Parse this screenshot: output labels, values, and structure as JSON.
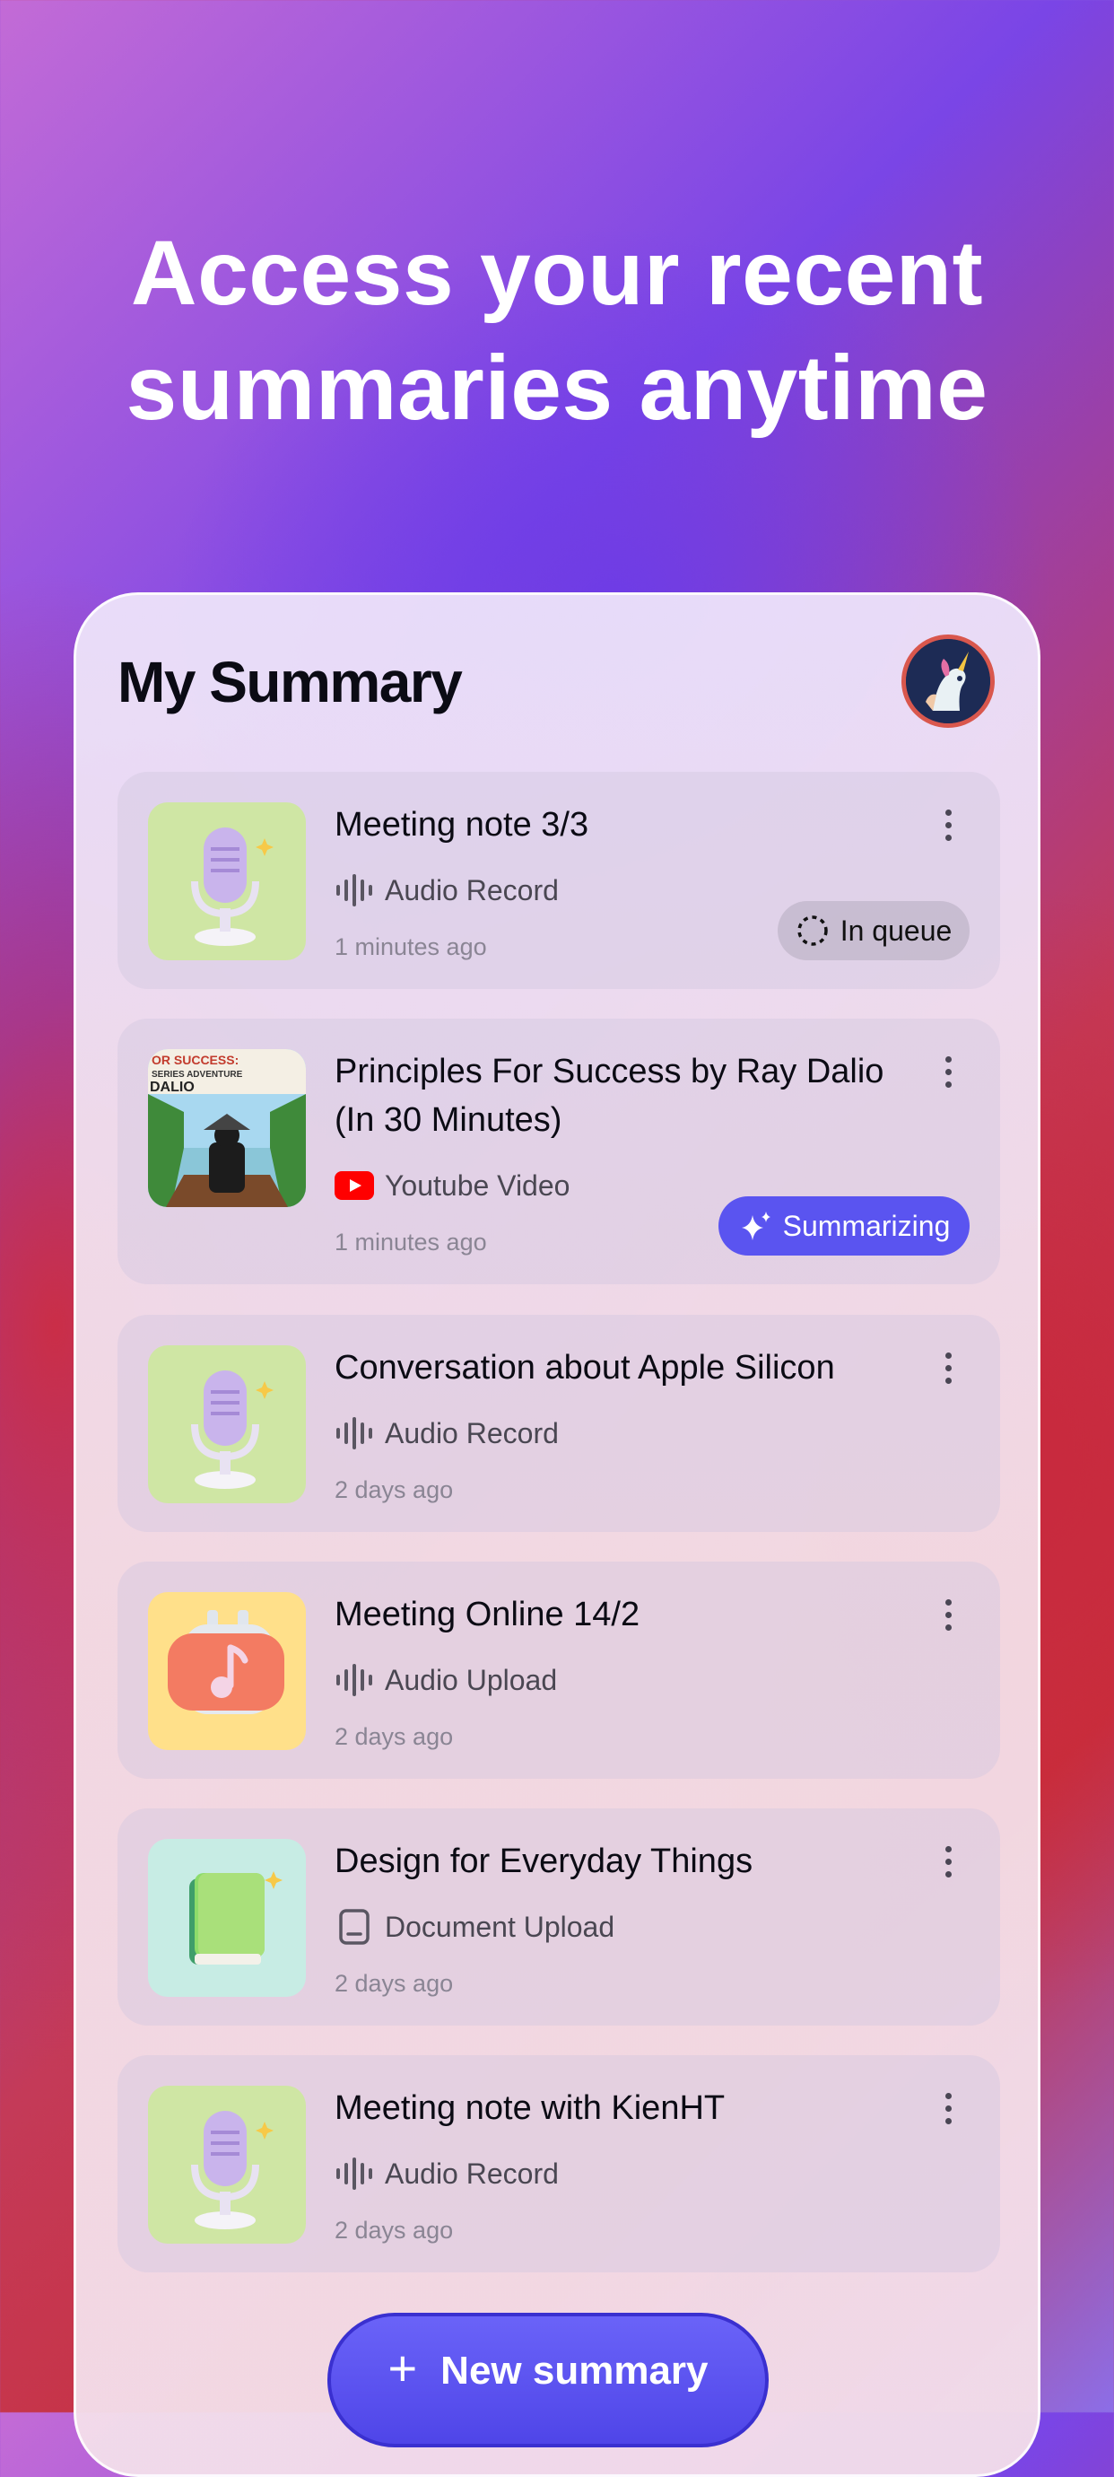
{
  "hero": {
    "line1": "Access your recent",
    "line2": "summaries anytime"
  },
  "header": {
    "title": "My Summary",
    "avatar_icon": "unicorn-avatar-icon"
  },
  "items": [
    {
      "title": "Meeting note 3/3",
      "source": "Audio Record",
      "source_icon": "waveform-icon",
      "time": "1 minutes ago",
      "thumb_icon": "microphone-icon",
      "status": "In queue"
    },
    {
      "title": "Principles For Success by Ray Dalio (In 30 Minutes)",
      "source": "Youtube Video",
      "source_icon": "youtube-icon",
      "time": "1 minutes ago",
      "thumb_icon": "video-thumbnail",
      "thumb_text1": "OR SUCCESS:",
      "thumb_text2": "SERIES ADVENTURE",
      "thumb_text3": "DALIO",
      "status": "Summarizing"
    },
    {
      "title": "Conversation about Apple Silicon",
      "source": "Audio Record",
      "source_icon": "waveform-icon",
      "time": "2 days ago",
      "thumb_icon": "microphone-icon"
    },
    {
      "title": "Meeting Online 14/2",
      "source": "Audio Upload",
      "source_icon": "waveform-icon",
      "time": "2 days ago",
      "thumb_icon": "music-note-icon"
    },
    {
      "title": "Design for Everyday Things",
      "source": "Document Upload",
      "source_icon": "document-icon",
      "time": "2 days ago",
      "thumb_icon": "book-icon"
    },
    {
      "title": "Meeting note with KienHT",
      "source": "Audio Record",
      "source_icon": "waveform-icon",
      "time": "2 days ago",
      "thumb_icon": "microphone-icon"
    }
  ],
  "new_button": {
    "label": "New summary"
  },
  "colors": {
    "accent": "#5a54f0",
    "youtube": "#ff0000"
  }
}
